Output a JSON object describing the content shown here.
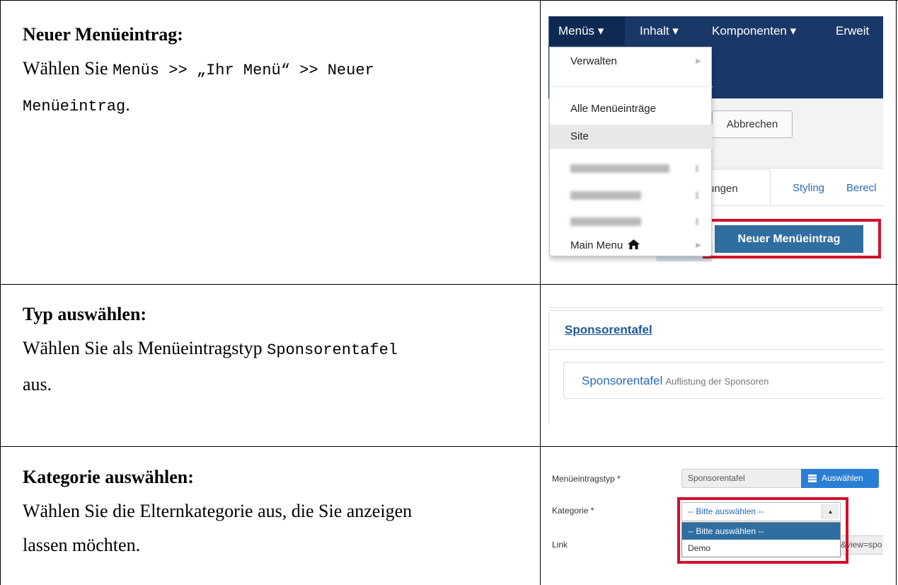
{
  "rows": [
    {
      "heading": "Neuer Menüeintrag:",
      "text_prefix": "Wählen Sie",
      "code_line1": "Menüs >> „Ihr Menü“ >> Neuer",
      "code_line2": "Menüeintrag",
      "text_suffix": "."
    },
    {
      "heading": "Typ auswählen:",
      "text_prefix": "Wählen Sie als Menüeintragstyp",
      "code": "Sponsorentafel",
      "text_suffix": "aus."
    },
    {
      "heading": "Kategorie auswählen:",
      "line1": "Wählen Sie die Elternkategorie aus, die Sie anzeigen",
      "line2": "lassen möchten."
    }
  ],
  "screenshot1": {
    "nav": [
      "Menüs ▾",
      "Inhalt ▾",
      "Komponenten ▾",
      "Erweit"
    ],
    "dropdown": {
      "manage": "Verwalten",
      "all_items": "Alle Menüeinträge",
      "site": "Site",
      "main_menu": "Main Menu"
    },
    "cancel_button": "Abbrechen",
    "tabs": [
      "ungen",
      "Styling",
      "Berecl"
    ],
    "new_item_button": "Neuer Menüeintrag",
    "home_icon": "home-icon"
  },
  "screenshot2": {
    "panel_title": "Sponsorentafel",
    "item_title": "Sponsorentafel",
    "item_description": "Auflistung der Sponsoren"
  },
  "screenshot3": {
    "label_type": "Menüeintragstyp *",
    "type_value": "Sponsorentafel",
    "select_button": "Auswählen",
    "label_category": "Kategorie *",
    "category_selected": "-- Bitte auswählen --",
    "options": [
      "-- Bitte auswählen --",
      "Demo"
    ],
    "label_link": "Link",
    "link_fragment": "&view=spo"
  },
  "colors": {
    "navbar": "#1a3867",
    "highlight_red": "#d0112b",
    "link_blue": "#2a69b8",
    "button_blue": "#2f6ea0"
  }
}
